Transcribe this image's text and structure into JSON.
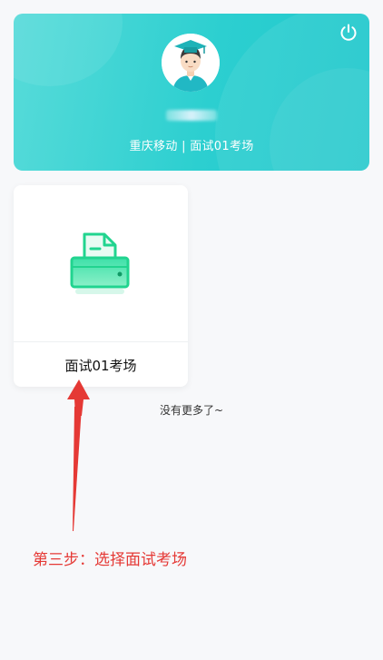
{
  "header": {
    "org": "重庆移动",
    "separator": "|",
    "room": "面试01考场",
    "org_line": "重庆移动 | 面试01考场",
    "power_icon": "power-icon",
    "avatar_icon": "graduate-avatar-icon",
    "accent_color": "#2ccfd0"
  },
  "exam_rooms": [
    {
      "name": "面试01考场",
      "icon": "printer-document-icon",
      "icon_color": "#21d48f"
    }
  ],
  "list_footer": "没有更多了~",
  "annotation": {
    "text": "第三步：选择面试考场",
    "color": "#e53935"
  }
}
